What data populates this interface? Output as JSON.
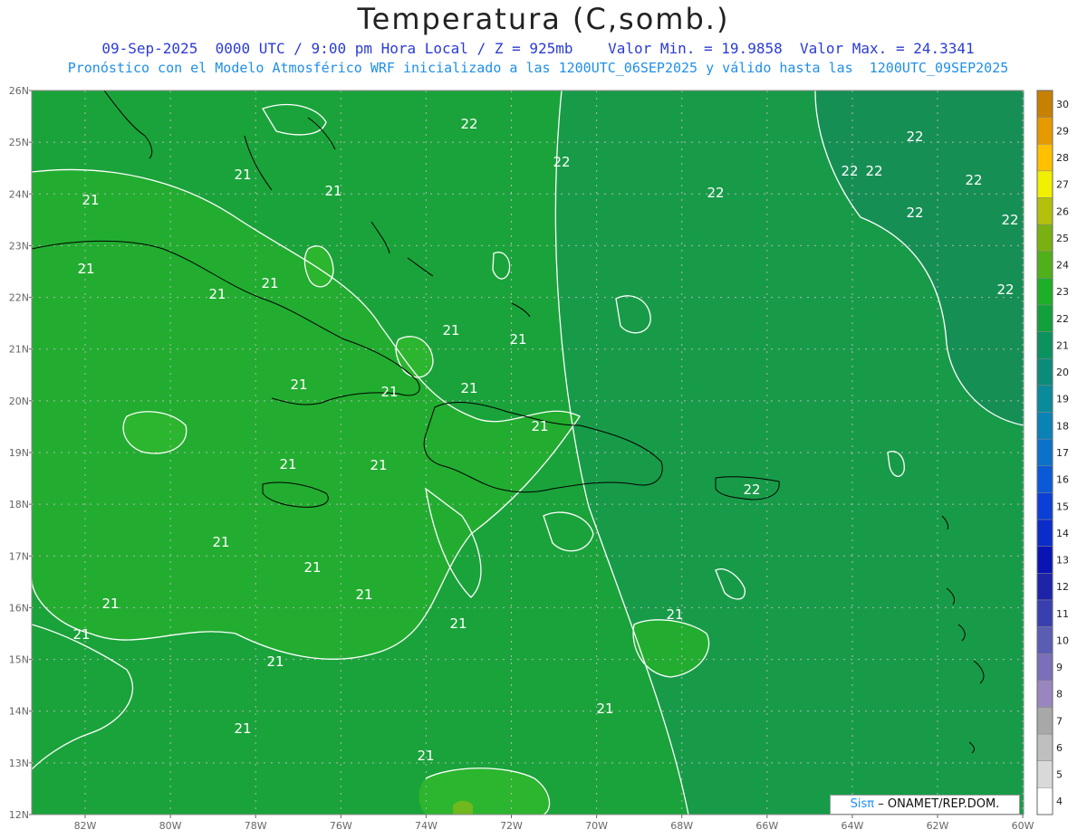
{
  "header": {
    "title": "Temperatura (C,somb.)",
    "line1": "09-Sep-2025  0000 UTC / 9:00 pm Hora Local / Z = 925mb    Valor Min. = 19.9858  Valor Max. = 24.3341",
    "line2": "Pronóstico con el Modelo Atmosférico WRF inicializado a las 1200UTC_06SEP2025 y válido hasta las  1200UTC_09SEP2025"
  },
  "map": {
    "lat_labels": [
      "26N",
      "25N",
      "24N",
      "23N",
      "22N",
      "21N",
      "20N",
      "19N",
      "18N",
      "17N",
      "16N",
      "15N",
      "14N",
      "13N",
      "12N"
    ],
    "lon_labels": [
      "82W",
      "80W",
      "78W",
      "76W",
      "74W",
      "72W",
      "70W",
      "68W",
      "66W",
      "64W",
      "62W",
      "60W"
    ],
    "contour_labels": [
      "21",
      "22"
    ],
    "colors": {
      "base": "#1aa33a",
      "warm": "#2cb52e",
      "cool": "#168f55",
      "contour": "#ffffff",
      "coast": "#000000",
      "grid": "#b5b5b5"
    }
  },
  "colorbar": {
    "ticks": [
      "4",
      "5",
      "6",
      "7",
      "8",
      "9",
      "10",
      "11",
      "12",
      "13",
      "14",
      "15",
      "16",
      "17",
      "18",
      "19",
      "20",
      "21",
      "22",
      "23",
      "24",
      "25",
      "26",
      "27",
      "28",
      "29",
      "30"
    ],
    "colors": [
      "#ffffff",
      "#d9d9d9",
      "#bfbfbf",
      "#a8a8a8",
      "#9a86bf",
      "#7a6fb8",
      "#5b5db3",
      "#3a3fb0",
      "#1e24a8",
      "#0a14b2",
      "#0a2cc9",
      "#0b3fd6",
      "#0a5ad6",
      "#0a72c9",
      "#0b82b5",
      "#0a8a9a",
      "#0b8c7a",
      "#0b925f",
      "#12a03c",
      "#1fae2a",
      "#4fb01a",
      "#7ab012",
      "#b4c00c",
      "#f0f000",
      "#ffc000",
      "#e69a00",
      "#c88000"
    ]
  },
  "credit": {
    "brand": "Sisπ",
    "text": "– ONAMET/REP.DOM."
  }
}
